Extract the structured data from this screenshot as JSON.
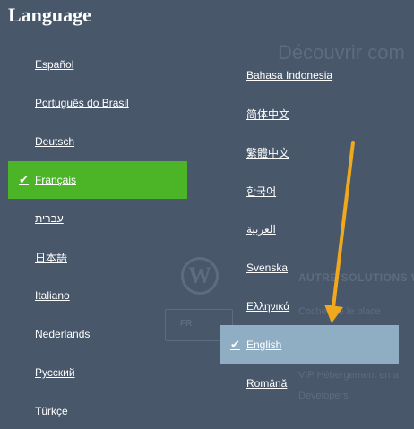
{
  "title": "Language",
  "background": {
    "heading": "Découvrir com",
    "logo": "W",
    "section": "AUTRE  SOLUTIONS W",
    "selector": "FR",
    "sub1": "Cocher de le place",
    "sub2": "VIP Hébergement en a",
    "sub3": "Developers"
  },
  "left_column": [
    {
      "label": "Español"
    },
    {
      "label": "Português do Brasil"
    },
    {
      "label": "Deutsch"
    },
    {
      "label": "Français",
      "selected": true
    },
    {
      "label": "עברית"
    },
    {
      "label": "日本語"
    },
    {
      "label": "Italiano"
    },
    {
      "label": "Nederlands"
    },
    {
      "label": "Русский"
    },
    {
      "label": "Türkçe"
    }
  ],
  "right_column": [
    {
      "label": "Bahasa Indonesia"
    },
    {
      "label": "简体中文"
    },
    {
      "label": "繁體中文"
    },
    {
      "label": "한국어"
    },
    {
      "label": "العربية"
    },
    {
      "label": "Svenska"
    },
    {
      "label": "Ελληνικά"
    },
    {
      "label": "English",
      "selected": true
    },
    {
      "label": "Română"
    }
  ],
  "check_symbol": "✔",
  "colors": {
    "panel_bg": "#48576a",
    "selected_green": "#4cb527",
    "selected_blue": "#8faec4",
    "arrow": "#f0a81c"
  }
}
